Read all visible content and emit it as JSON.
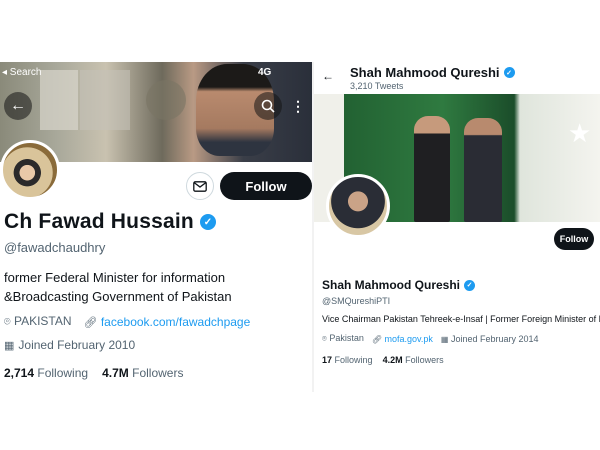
{
  "left": {
    "status_back": "◂ Search",
    "status_network": "4G",
    "name": "Ch Fawad Hussain",
    "handle": "@fawadchaudhry",
    "bio": "former Federal Minister for information &Broadcasting Government of Pakistan",
    "location": "PAKISTAN",
    "website": "facebook.com/fawadchpage",
    "joined": "Joined February 2010",
    "following_count": "2,714",
    "following_label": "Following",
    "followers_count": "4.7M",
    "followers_label": "Followers",
    "follow_label": "Follow"
  },
  "right": {
    "top_name": "Shah Mahmood Qureshi",
    "top_tweets": "3,210 Tweets",
    "name": "Shah Mahmood Qureshi",
    "handle": "@SMQureshiPTI",
    "bio": "Vice Chairman Pakistan Tehreek-e-Insaf | Former Foreign Minister of Pakistan",
    "location": "Pakistan",
    "website": "mofa.gov.pk",
    "joined": "Joined February 2014",
    "following_count": "17",
    "following_label": "Following",
    "followers_count": "4.2M",
    "followers_label": "Followers",
    "follow_label": "Follow"
  },
  "colors": {
    "accent": "#1d9bf0",
    "button_dark": "#0f1419",
    "muted_text": "#536471"
  },
  "icons": [
    "back-arrow-icon",
    "search-icon",
    "more-icon",
    "mail-icon",
    "verified-badge-icon",
    "location-icon",
    "link-icon",
    "calendar-icon"
  ]
}
